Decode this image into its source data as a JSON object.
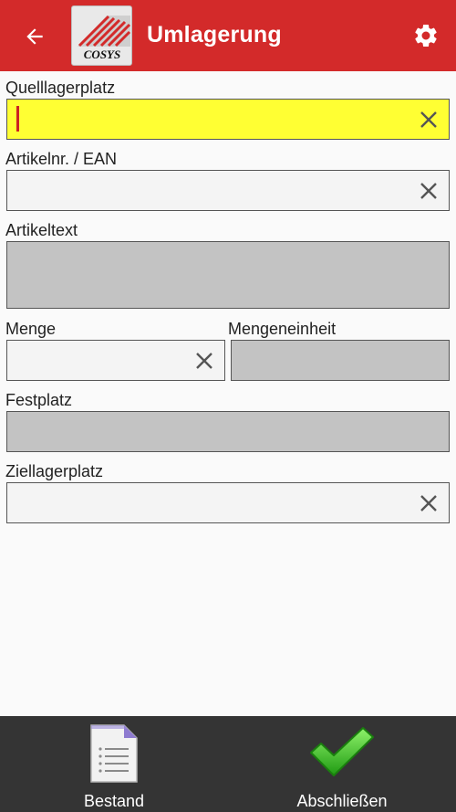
{
  "appbar": {
    "title": "Umlagerung",
    "back_icon": "arrow-left-icon",
    "settings_icon": "gear-icon",
    "logo_text": "COSYS",
    "color": "#d32a2a"
  },
  "form": {
    "source_location": {
      "label": "Quelllagerplatz",
      "value": "",
      "highlight_color": "#ffff33"
    },
    "article_number": {
      "label": "Artikelnr. / EAN",
      "value": ""
    },
    "article_text": {
      "label": "Artikeltext",
      "value": ""
    },
    "quantity": {
      "label": "Menge",
      "value": ""
    },
    "unit": {
      "label": "Mengeneinheit",
      "value": ""
    },
    "fixed_location": {
      "label": "Festplatz",
      "value": ""
    },
    "target_location": {
      "label": "Ziellagerplatz",
      "value": ""
    }
  },
  "bottom_bar": {
    "stock": {
      "label": "Bestand",
      "icon": "document-list-icon"
    },
    "finish": {
      "label": "Abschließen",
      "icon": "checkmark-icon"
    }
  }
}
